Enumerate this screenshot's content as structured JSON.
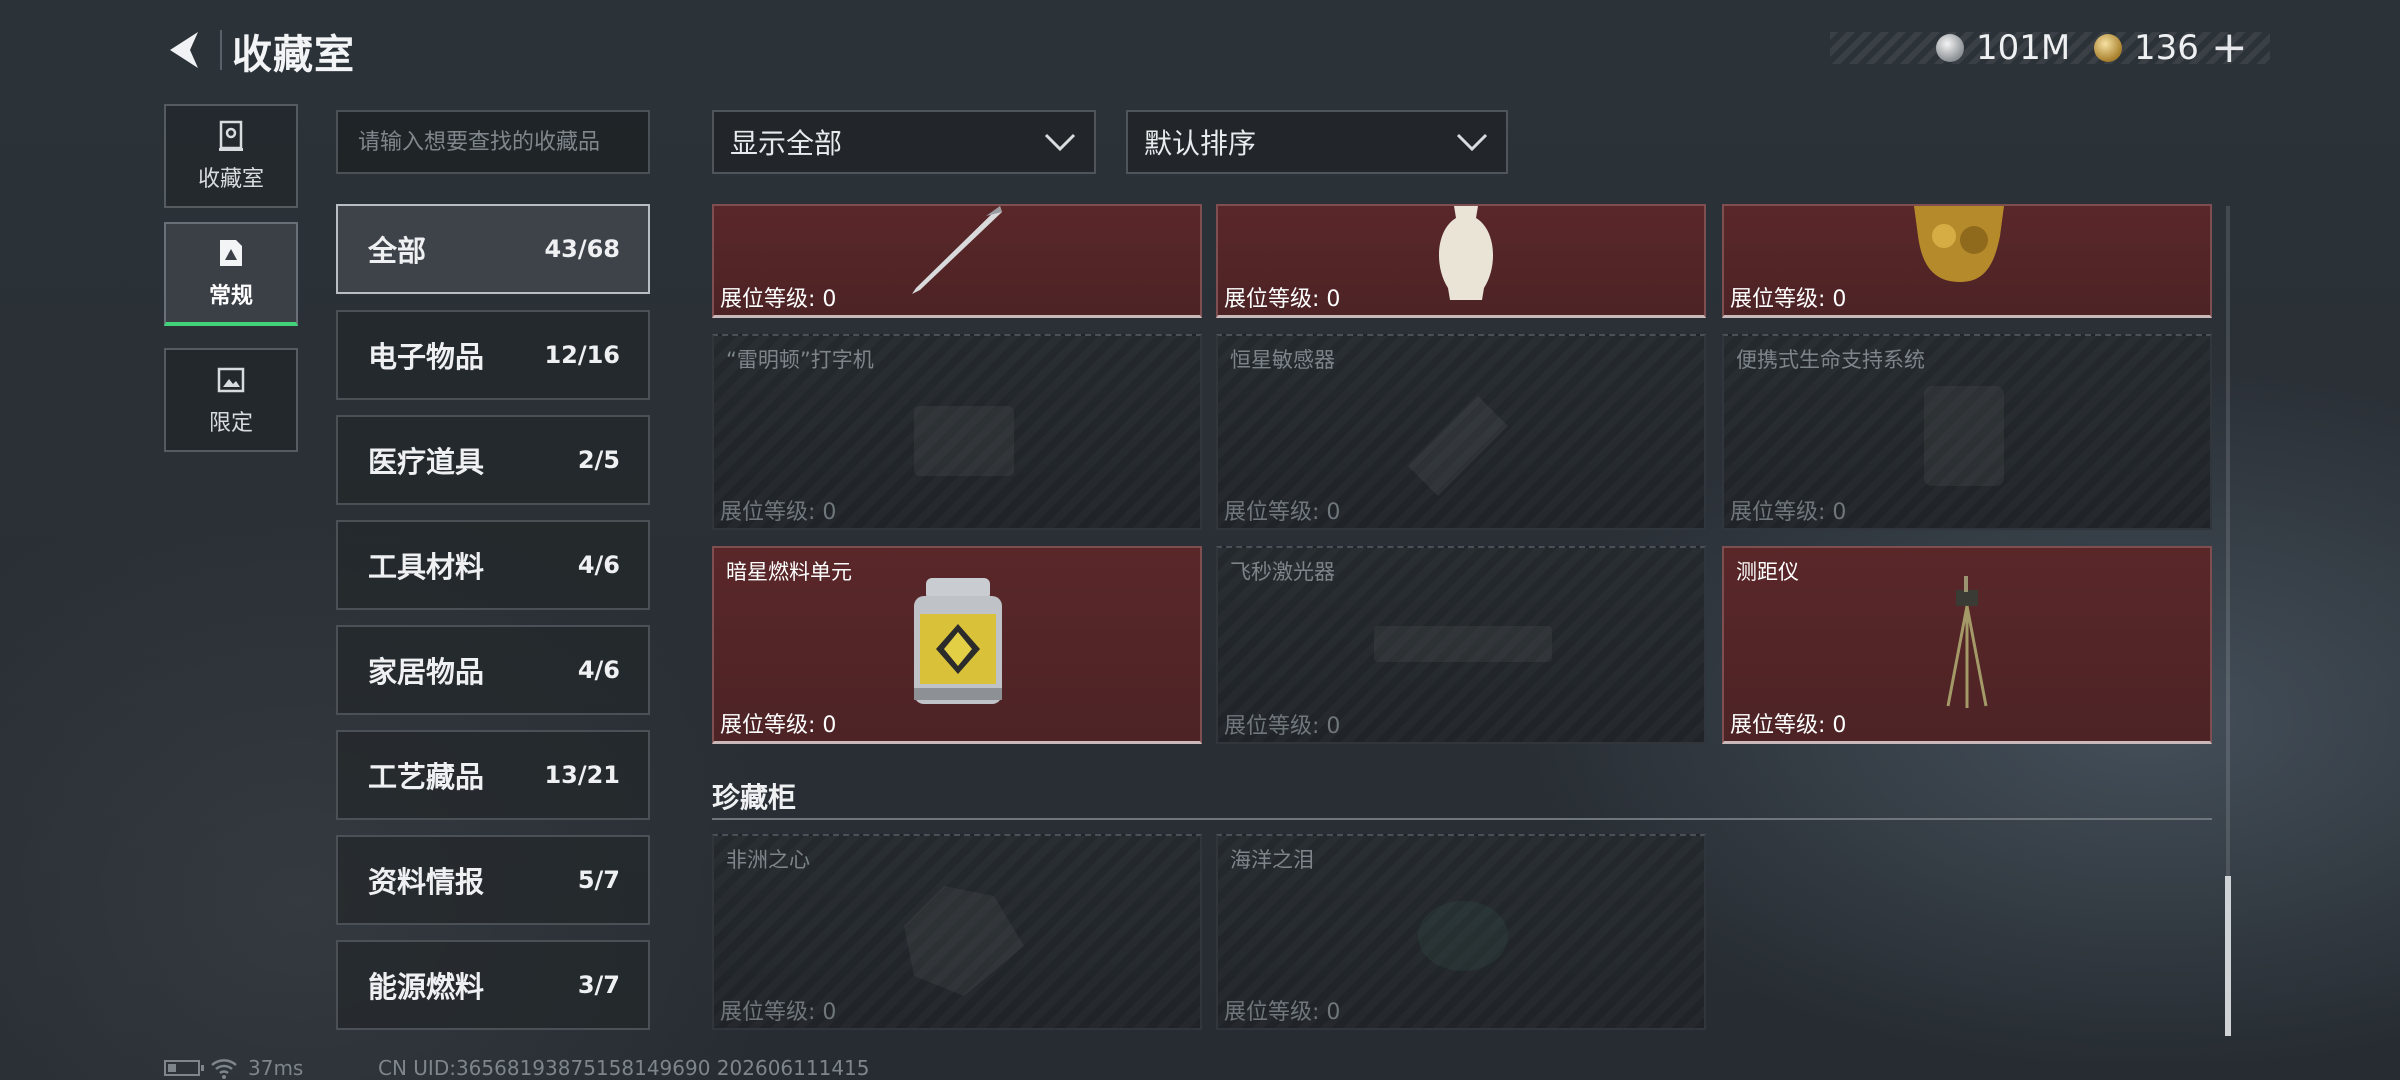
{
  "header": {
    "title": "收藏室",
    "currency_silver": "101M",
    "currency_gold": "136",
    "plus_label": "+"
  },
  "nav": {
    "tabs": [
      {
        "label": "收藏室",
        "icon": "vault-icon"
      },
      {
        "label": "常规",
        "icon": "document-icon",
        "active": true
      },
      {
        "label": "限定",
        "icon": "image-icon"
      }
    ]
  },
  "search": {
    "placeholder": "请输入想要查找的收藏品"
  },
  "categories": [
    {
      "label": "全部",
      "count": "43/68",
      "active": true
    },
    {
      "label": "电子物品",
      "count": "12/16"
    },
    {
      "label": "医疗道具",
      "count": "2/5"
    },
    {
      "label": "工具材料",
      "count": "4/6"
    },
    {
      "label": "家居物品",
      "count": "4/6"
    },
    {
      "label": "工艺藏品",
      "count": "13/21"
    },
    {
      "label": "资料情报",
      "count": "5/7"
    },
    {
      "label": "能源燃料",
      "count": "3/7"
    }
  ],
  "filters": {
    "show": "显示全部",
    "sort": "默认排序"
  },
  "level_label": "展位等级: 0",
  "grid": [
    {
      "name": "",
      "owned": true,
      "icon": "pen-icon"
    },
    {
      "name": "",
      "owned": true,
      "icon": "vase-icon"
    },
    {
      "name": "",
      "owned": true,
      "icon": "gold-statue-icon"
    },
    {
      "name": "“雷明顿”打字机",
      "owned": false,
      "icon": "typewriter-icon"
    },
    {
      "name": "恒星敏感器",
      "owned": false,
      "icon": "sensor-icon"
    },
    {
      "name": "便携式生命支持系统",
      "owned": false,
      "icon": "life-support-icon"
    },
    {
      "name": "暗星燃料单元",
      "owned": true,
      "icon": "fuel-canister-icon"
    },
    {
      "name": "飞秒激光器",
      "owned": false,
      "icon": "laser-icon"
    },
    {
      "name": "测距仪",
      "owned": true,
      "icon": "rangefinder-icon"
    }
  ],
  "cabinet": {
    "title": "珍藏柜",
    "items": [
      {
        "name": "非洲之心",
        "owned": false,
        "icon": "diamond-icon"
      },
      {
        "name": "海洋之泪",
        "owned": false,
        "icon": "gem-icon"
      }
    ]
  },
  "footer": {
    "ping": "37ms",
    "uid": "CN UID:3656819387515814969​0 202606111415"
  },
  "colors": {
    "owned_card": "#5a2729",
    "active_tab_accent": "#42d27a",
    "background": "#2a3036"
  }
}
